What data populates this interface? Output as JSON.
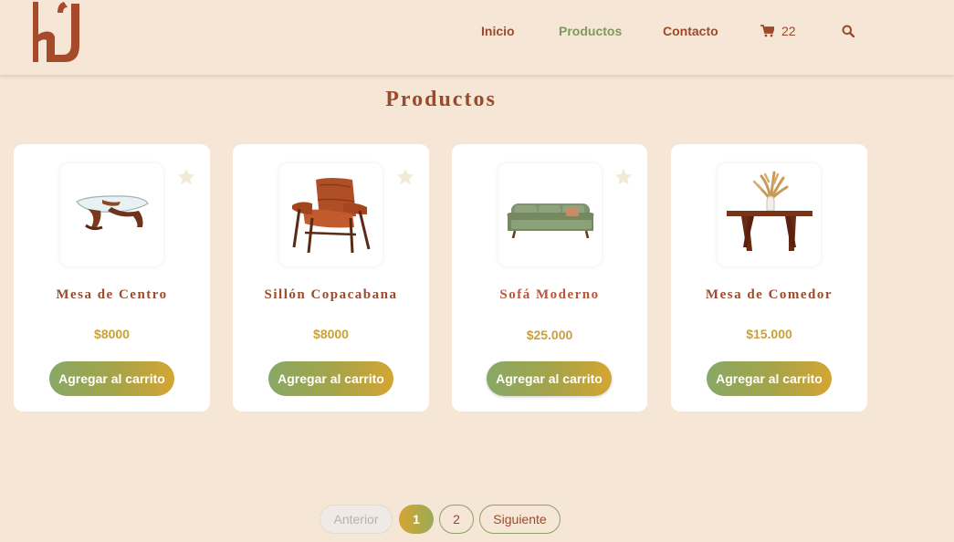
{
  "nav": {
    "items": [
      {
        "label": "Inicio",
        "active": false
      },
      {
        "label": "Productos",
        "active": true
      },
      {
        "label": "Contacto",
        "active": false
      }
    ],
    "cart_count": "22",
    "icons": {
      "cart": "cart-icon",
      "search": "search-icon"
    }
  },
  "page": {
    "title": "Productos"
  },
  "products": [
    {
      "name": "Mesa de Centro",
      "price": "$8000",
      "button": "Agregar al carrito",
      "favorite_icon": "star-icon"
    },
    {
      "name": "Sillón Copacabana",
      "price": "$8000",
      "button": "Agregar al carrito",
      "favorite_icon": "star-icon"
    },
    {
      "name": "Sofá Moderno",
      "price": "$25.000",
      "button": "Agregar al carrito",
      "favorite_icon": "star-icon"
    },
    {
      "name": "Mesa de Comedor",
      "price": "$15.000",
      "button": "Agregar al carrito",
      "favorite_icon": null
    }
  ],
  "pagination": {
    "prev": "Anterior",
    "pages": [
      "1",
      "2"
    ],
    "current": "1",
    "next": "Siguiente"
  },
  "colors": {
    "background": "#f5e6d6",
    "brand": "#9b4a2c",
    "active_nav": "#7e9a5a",
    "price": "#c9a03c",
    "button_gradient": [
      "#88a866",
      "#d4a532"
    ]
  }
}
